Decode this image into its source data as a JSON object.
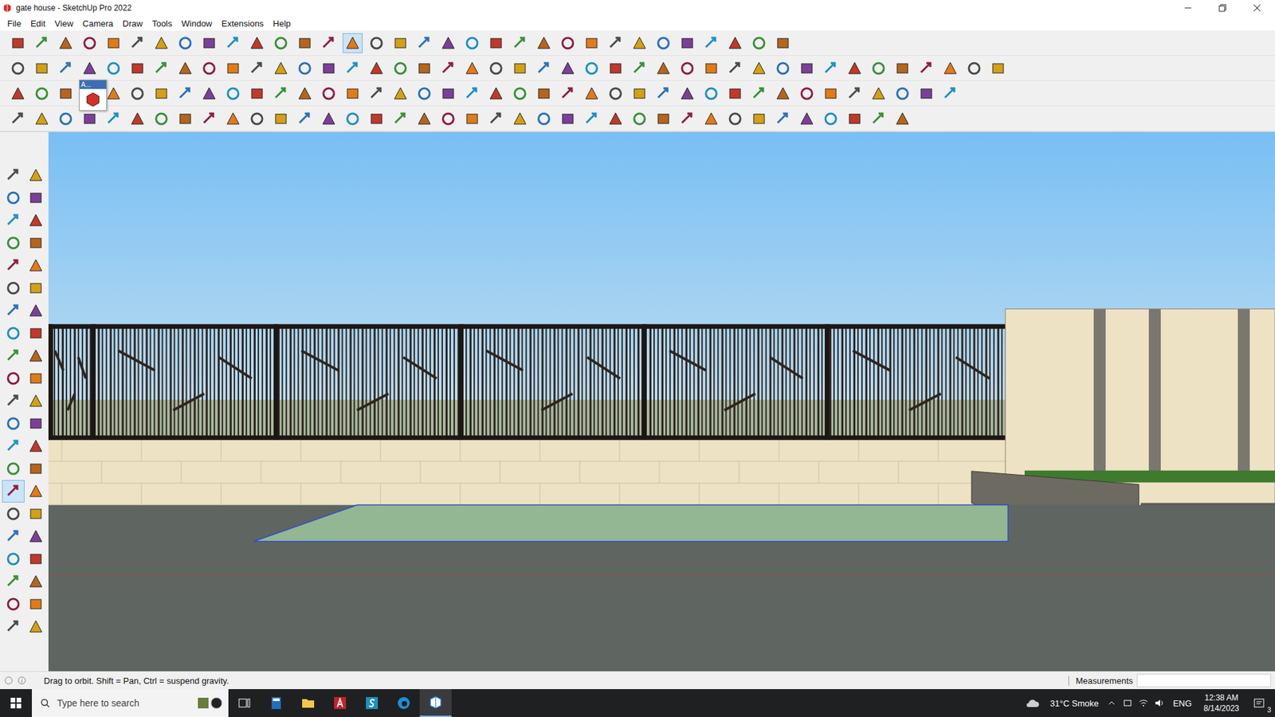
{
  "window": {
    "title": "gate house - SketchUp Pro 2022"
  },
  "menu": [
    "File",
    "Edit",
    "View",
    "Camera",
    "Draw",
    "Tools",
    "Window",
    "Extensions",
    "Help"
  ],
  "toolbars": [
    {
      "selected": [
        false,
        false,
        false,
        false,
        false,
        false,
        false,
        false,
        false,
        false,
        false,
        false,
        false,
        false,
        true,
        false,
        false,
        false,
        false,
        false,
        false,
        false,
        false,
        false,
        false,
        false,
        false,
        false,
        false,
        false,
        false,
        false,
        false
      ]
    },
    {
      "selected": [
        false,
        false,
        false,
        false,
        false,
        false,
        false,
        false,
        false,
        false,
        false,
        false,
        false,
        false,
        false,
        false,
        false,
        false,
        false,
        false,
        false,
        false,
        false,
        false,
        false,
        false,
        false,
        false,
        false,
        false,
        false,
        false,
        false,
        false,
        false,
        false,
        false,
        false,
        false,
        false,
        false,
        false
      ]
    },
    {
      "selected": [
        false,
        false,
        false,
        false,
        false,
        false,
        false,
        false,
        false,
        false,
        false,
        false,
        false,
        false,
        false,
        false,
        false,
        false,
        false,
        false,
        false,
        false,
        false,
        false,
        false,
        false,
        false,
        false,
        false,
        false,
        false,
        false,
        false,
        false,
        false,
        false,
        false,
        false,
        false,
        false
      ]
    },
    {
      "selected": [
        false,
        false,
        false,
        false,
        false,
        false,
        false,
        false,
        false,
        false,
        false,
        false,
        false,
        false,
        false,
        false,
        false,
        false,
        false,
        false,
        false,
        false,
        false,
        false,
        false,
        false,
        false,
        false,
        false,
        false,
        false,
        false,
        false,
        false,
        false,
        false,
        false,
        false
      ]
    }
  ],
  "floating_toolbar": {
    "label": "A..."
  },
  "left_toolbar": {
    "selected": [
      false,
      false,
      false,
      false,
      false,
      false,
      false,
      false,
      false,
      false,
      false,
      false,
      false,
      false,
      false,
      false,
      false,
      false,
      false,
      false,
      false,
      false,
      false,
      false,
      false,
      false,
      false,
      false,
      true,
      false,
      false,
      false,
      false,
      false,
      false,
      false,
      false,
      false,
      false,
      false,
      false,
      false
    ]
  },
  "status_bar": {
    "hint": "Drag to orbit. Shift = Pan, Ctrl = suspend gravity.",
    "measurements_label": "Measurements",
    "measurements_value": ""
  },
  "taskbar": {
    "search_placeholder": "Type here to search",
    "weather": "31°C Smoke",
    "language": "ENG",
    "time": "12:38 AM",
    "date": "8/14/2023",
    "notifications": "3"
  }
}
